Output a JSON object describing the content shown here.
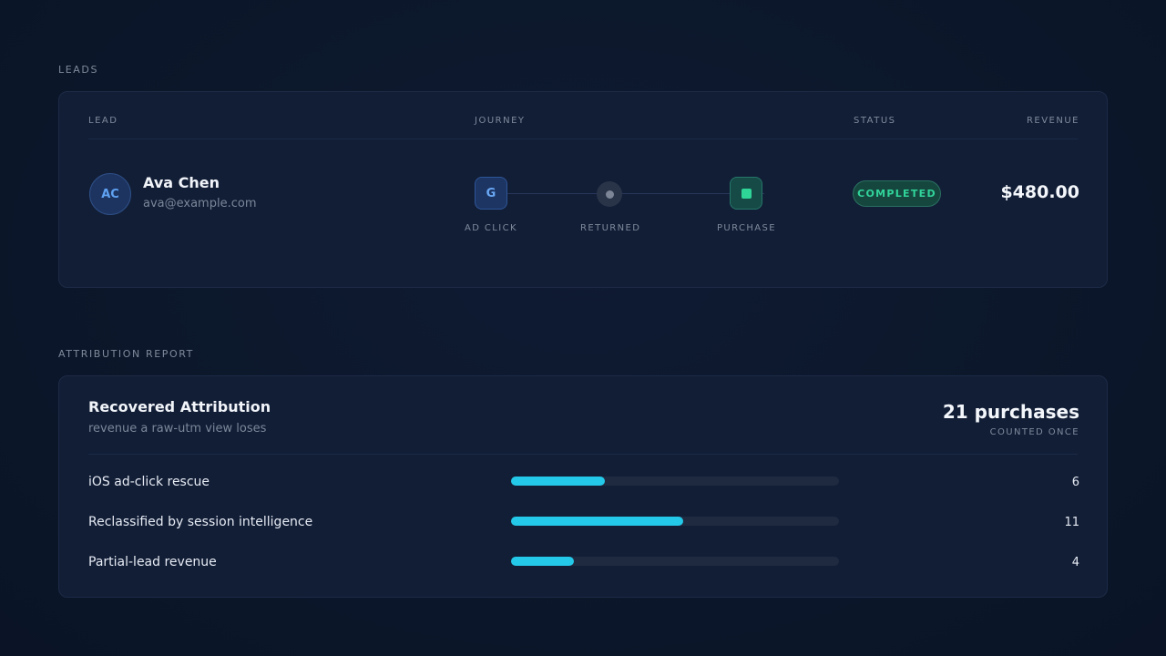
{
  "leads_section": {
    "label": "LEADS",
    "headers": {
      "lead": "LEAD",
      "journey": "JOURNEY",
      "status": "STATUS",
      "revenue": "REVENUE"
    },
    "lead": {
      "initials": "AC",
      "name": "Ava Chen",
      "email": "ava@example.com",
      "journey": [
        {
          "icon": "google-icon",
          "glyph": "G",
          "label": "AD CLICK"
        },
        {
          "icon": "dot-icon",
          "label": "RETURNED"
        },
        {
          "icon": "square-icon",
          "label": "PURCHASE"
        }
      ],
      "status": "COMPLETED",
      "revenue": "$480.00"
    }
  },
  "attribution_section": {
    "label": "ATTRIBUTION REPORT",
    "title": "Recovered Attribution",
    "subtitle": "revenue a raw-utm view loses",
    "count": "21 purchases",
    "count_sub": "COUNTED ONCE",
    "rows": [
      {
        "label": "iOS ad-click rescue",
        "value": "6",
        "fraction": 0.2857
      },
      {
        "label": "Reclassified by session intelligence",
        "value": "11",
        "fraction": 0.5238
      },
      {
        "label": "Partial-lead revenue",
        "value": "4",
        "fraction": 0.1905
      }
    ]
  },
  "colors": {
    "accent_bar": "#24c8e8",
    "status_completed": "#31d49a",
    "avatar_text": "#5fa2f2"
  }
}
